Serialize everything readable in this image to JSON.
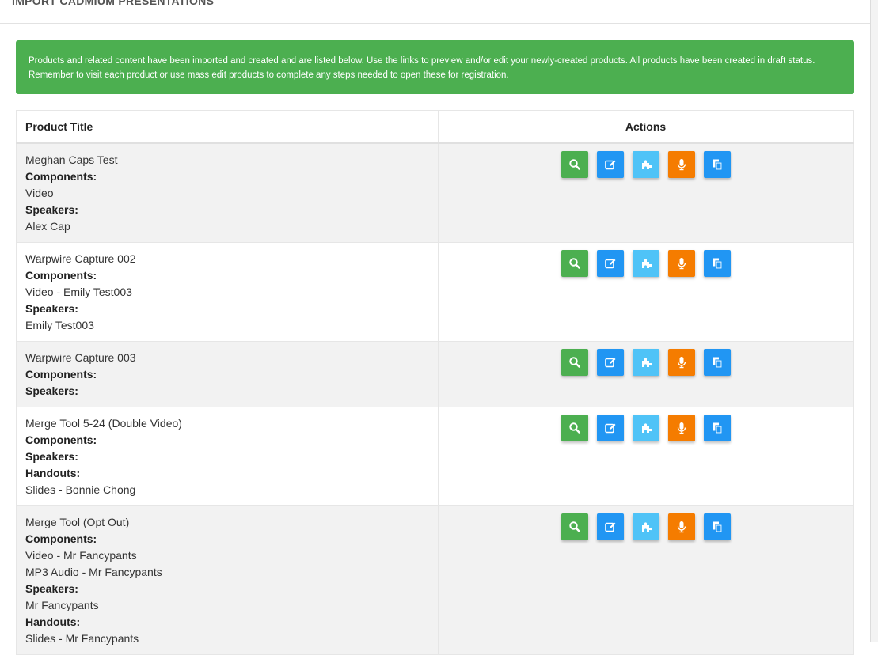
{
  "header": {
    "title": "IMPORT CADMIUM PRESENTATIONS"
  },
  "alert": {
    "message": "Products and related content have been imported and created and are listed below. Use the links to preview and/or edit your newly-created products. All products have been created in draft status. Remember to visit each product or use mass edit products to complete any steps needed to open these for registration."
  },
  "table": {
    "columns": [
      "Product Title",
      "Actions"
    ],
    "labels": {
      "components": "Components:",
      "speakers": "Speakers:",
      "handouts": "Handouts:"
    },
    "rows": [
      {
        "title": "Meghan Caps Test",
        "components": [
          "Video"
        ],
        "speakers": [
          "Alex Cap"
        ],
        "handouts": null
      },
      {
        "title": "Warpwire Capture 002",
        "components": [
          "Video - Emily Test003"
        ],
        "speakers": [
          "Emily Test003"
        ],
        "handouts": null
      },
      {
        "title": "Warpwire Capture 003",
        "components": [],
        "speakers": [],
        "handouts": null
      },
      {
        "title": "Merge Tool 5-24 (Double Video)",
        "components": [],
        "speakers": [],
        "handouts": [
          "Slides - Bonnie Chong"
        ]
      },
      {
        "title": "Merge Tool (Opt Out)",
        "components": [
          "Video - Mr Fancypants",
          "MP3 Audio - Mr Fancypants"
        ],
        "speakers": [
          "Mr Fancypants"
        ],
        "handouts": [
          "Slides - Mr Fancypants"
        ]
      }
    ]
  },
  "actions": [
    {
      "name": "preview-button",
      "icon": "search-icon",
      "color": "#4caf50"
    },
    {
      "name": "edit-button",
      "icon": "edit-icon",
      "color": "#2196f3"
    },
    {
      "name": "components-button",
      "icon": "puzzle-icon",
      "color": "#4fc3f7"
    },
    {
      "name": "speakers-button",
      "icon": "microphone-icon",
      "color": "#f57c00"
    },
    {
      "name": "copy-button",
      "icon": "copy-icon",
      "color": "#2196f3"
    }
  ]
}
